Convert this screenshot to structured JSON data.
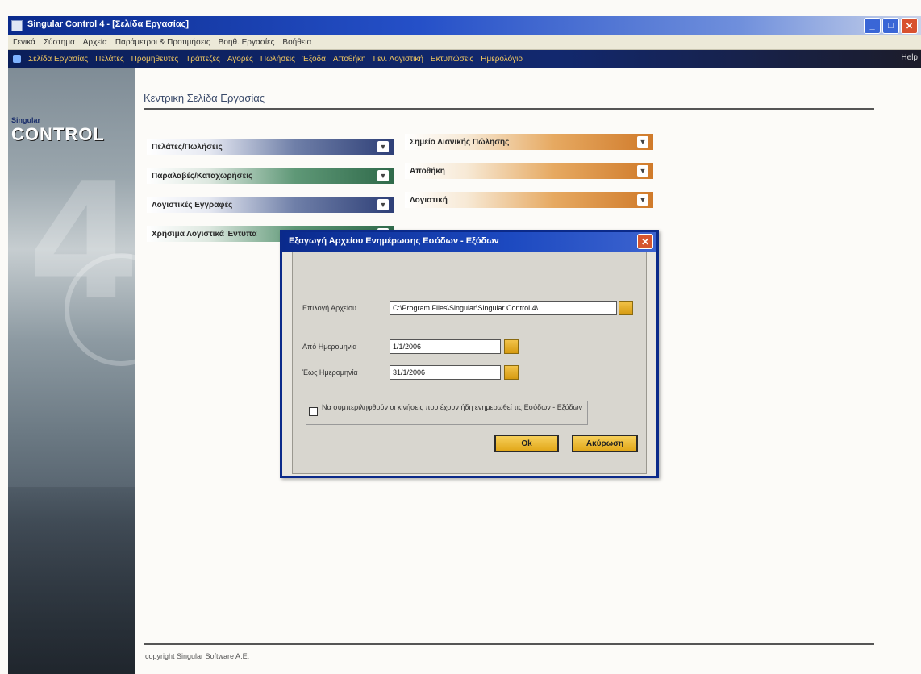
{
  "window": {
    "title": "Singular Control 4 - [Σελίδα Εργασίας]",
    "controls": {
      "minimize": "_",
      "maximize": "□",
      "close": "✕"
    }
  },
  "menubar": {
    "items": [
      "Γενικά",
      "Σύστημα",
      "Αρχεία",
      "Παράμετροι & Προτιμήσεις",
      "Βοηθ. Εργασίες",
      "Βοήθεια"
    ]
  },
  "toolbar": {
    "items": [
      "Σελίδα Εργασίας",
      "Πελάτες",
      "Προμηθευτές",
      "Τράπεζες",
      "Αγορές",
      "Πωλήσεις",
      "Έξοδα",
      "Αποθήκη",
      "Γεν. Λογιστική",
      "Εκτυπώσεις",
      "Ημερολόγιο"
    ],
    "help": "Help"
  },
  "banner": {
    "logo_small": "Singular",
    "logo_big": "CONTROL",
    "logo_version": "4"
  },
  "main": {
    "title": "Κεντρική Σελίδα Εργασίας",
    "buttons_left": [
      {
        "label": "Πελάτες/Πωλήσεις",
        "color": "blue"
      },
      {
        "label": "Παραλαβές/Καταχωρήσεις",
        "color": "green"
      },
      {
        "label": "Λογιστικές Εγγραφές",
        "color": "blue"
      },
      {
        "label": "Χρήσιμα Λογιστικά Έντυπα",
        "color": "green"
      }
    ],
    "buttons_right": [
      {
        "label": "Σημείο Λιανικής Πώλησης",
        "color": "orange"
      },
      {
        "label": "Αποθήκη",
        "color": "orange"
      },
      {
        "label": "Λογιστική",
        "color": "orange"
      }
    ],
    "footer": "copyright Singular Software A.E."
  },
  "dialog": {
    "title": "Εξαγωγή Αρχείου Ενημέρωσης Εσόδων - Εξόδων",
    "close": "✕",
    "file_label": "Επιλογή Αρχείου",
    "file_value": "C:\\Program Files\\Singular\\Singular Control 4\\...",
    "from_label": "Από Ημερομηνία",
    "from_value": "1/1/2006",
    "to_label": "Έως Ημερομηνία",
    "to_value": "31/1/2006",
    "checkbox_label": "Να συμπεριληφθούν οι κινήσεις που έχουν ήδη ενημερωθεί τις Εσόδων - Εξόδων",
    "ok": "Ok",
    "cancel": "Ακύρωση"
  }
}
